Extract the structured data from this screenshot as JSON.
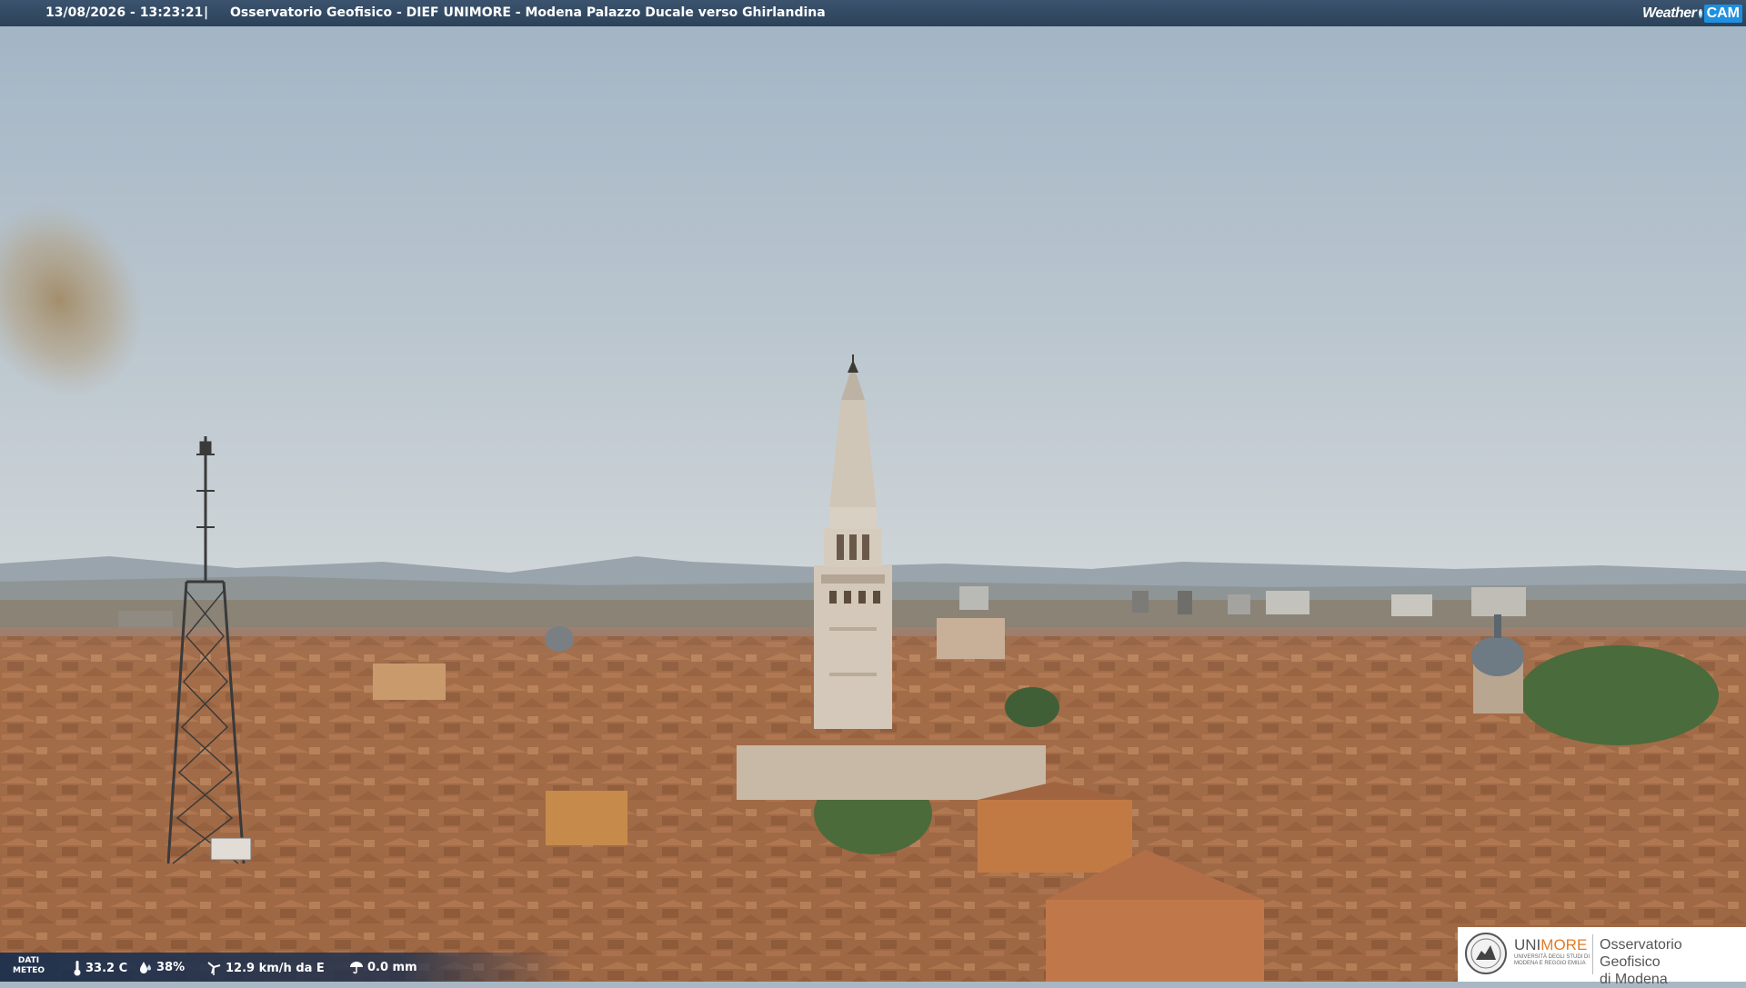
{
  "header": {
    "timestamp": "13/08/2026 - 13:23:21",
    "separator": "|",
    "title": "Osservatorio Geofisico - DIEF UNIMORE - Modena Palazzo Ducale verso Ghirlandina"
  },
  "brand": {
    "weather": "Weather",
    "cam": "CAM"
  },
  "weather": {
    "label_line1": "DATI",
    "label_line2": "METEO",
    "temperature": "33.2 C",
    "humidity": "38%",
    "wind": "12.9 km/h da E",
    "rain": "0.0 mm"
  },
  "logo": {
    "uni": "UNI",
    "more": "MORE",
    "sub": "UNIVERSITÀ DEGLI STUDI DI MODENA E REGGIO EMILIA",
    "observatory_line1": "Osservatorio Geofisico",
    "observatory_line2": "di Modena"
  },
  "colors": {
    "sky_top": "#a2b5c6",
    "sky_bottom": "#c7d0d6",
    "roof": "#a8714b",
    "tower": "#cfc4b6",
    "bar": "#2f465f",
    "brand_accent": "#e27b26"
  }
}
